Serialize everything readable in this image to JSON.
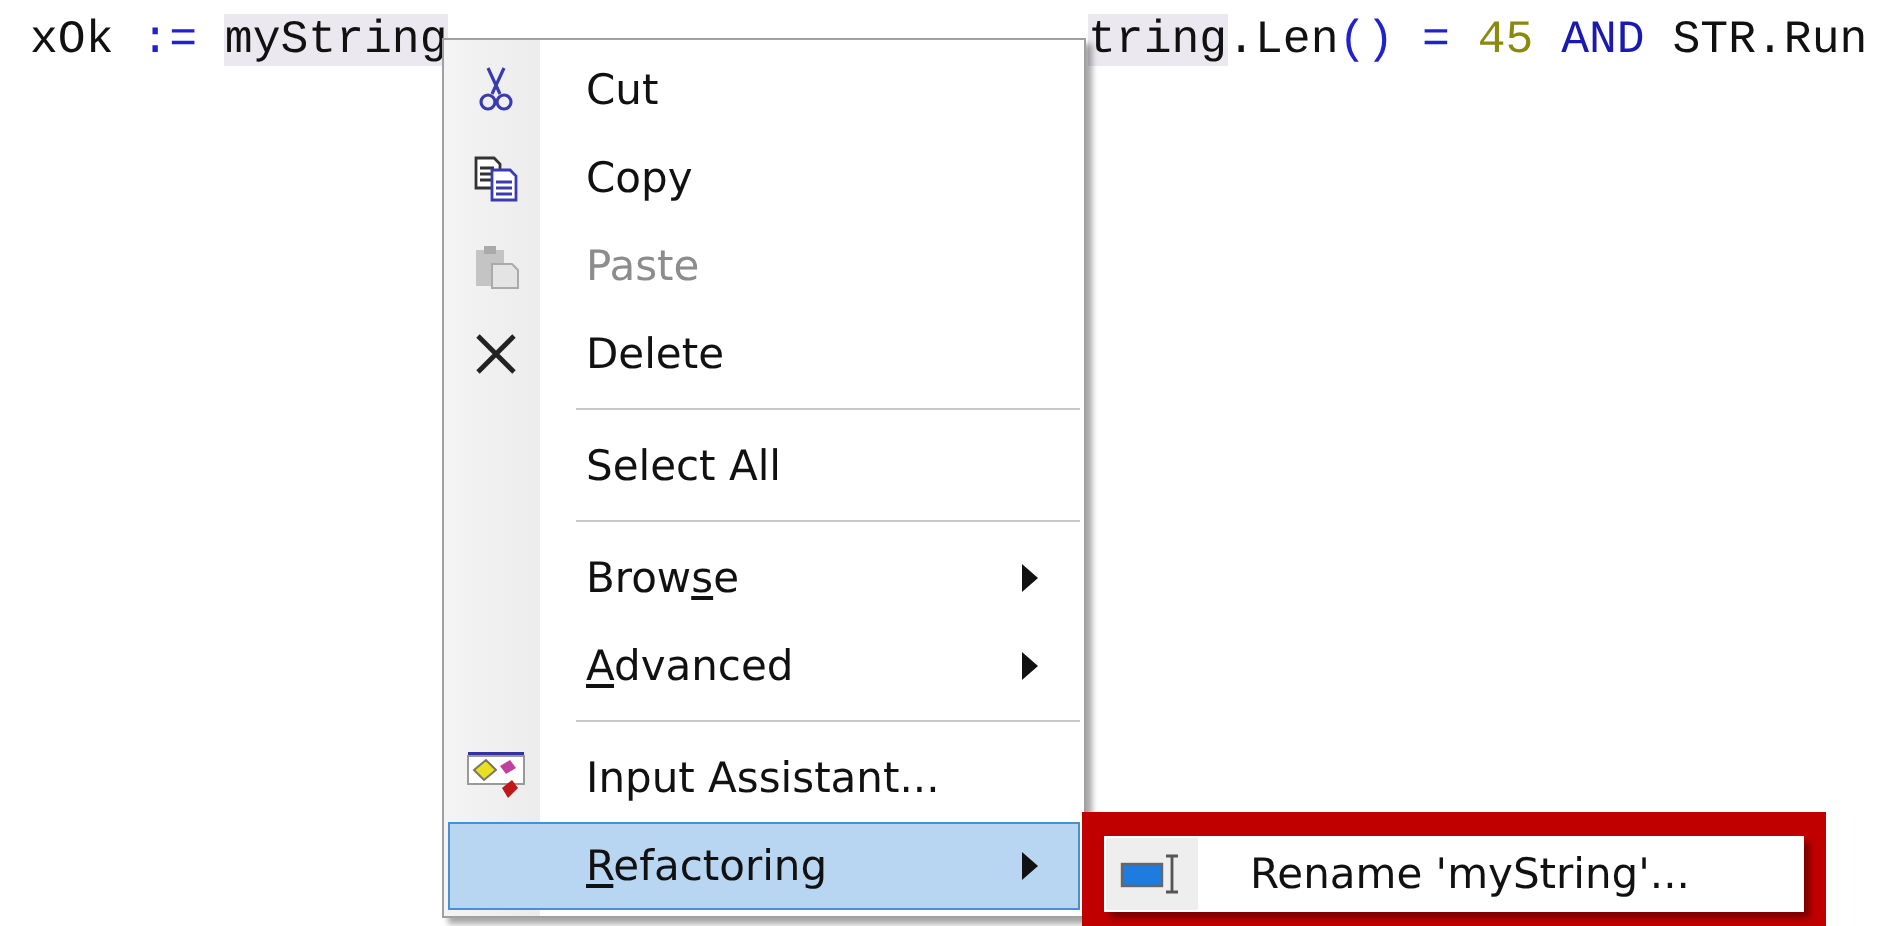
{
  "code_line": {
    "before_menu": [
      {
        "kind": "identifier",
        "text": "xOk "
      },
      {
        "kind": "operator",
        "text": ":= "
      },
      {
        "kind": "highlight",
        "text": "myString"
      }
    ],
    "after_menu": [
      {
        "kind": "highlight",
        "text": "tring"
      },
      {
        "kind": "identifier",
        "text": ".Len"
      },
      {
        "kind": "operator",
        "text": "() = "
      },
      {
        "kind": "number",
        "text": "45 "
      },
      {
        "kind": "keyword",
        "text": "AND "
      },
      {
        "kind": "identifier",
        "text": "STR.Run"
      }
    ]
  },
  "context_menu": {
    "items": [
      {
        "kind": "cut",
        "label": "Cut",
        "disabled": false,
        "selected": false
      },
      {
        "kind": "copy",
        "label": "Copy",
        "disabled": false,
        "selected": false
      },
      {
        "kind": "paste",
        "label": "Paste",
        "disabled": true,
        "selected": false
      },
      {
        "kind": "delete",
        "label": "Delete",
        "disabled": false,
        "selected": false
      },
      {
        "kind": "separator"
      },
      {
        "kind": "plain",
        "label": "Select All",
        "disabled": false,
        "selected": false
      },
      {
        "kind": "separator"
      },
      {
        "kind": "submenu",
        "pre": "Brow",
        "key": "s",
        "post": "e",
        "disabled": false,
        "selected": false
      },
      {
        "kind": "submenu",
        "key": "A",
        "post": "dvanced",
        "disabled": false,
        "selected": false
      },
      {
        "kind": "separator"
      },
      {
        "kind": "assistant",
        "label": "Input Assistant...",
        "disabled": false,
        "selected": false
      },
      {
        "kind": "submenu",
        "key": "R",
        "post": "efactoring",
        "disabled": false,
        "selected": true
      }
    ]
  },
  "submenu": {
    "items": [
      {
        "kind": "rename",
        "label": "Rename 'myString'...",
        "disabled": false,
        "selected": false
      }
    ]
  }
}
